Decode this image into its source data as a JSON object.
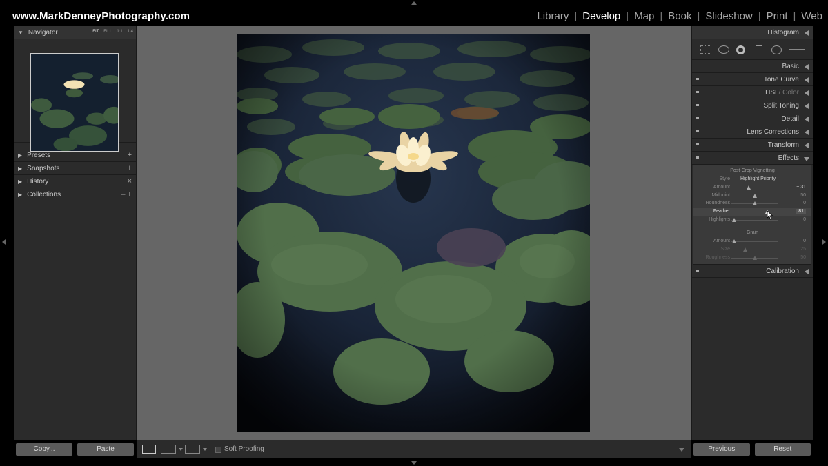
{
  "header": {
    "site_title": "www.MarkDenneyPhotography.com",
    "modules": [
      {
        "label": "Library",
        "active": false
      },
      {
        "label": "Develop",
        "active": true
      },
      {
        "label": "Map",
        "active": false
      },
      {
        "label": "Book",
        "active": false
      },
      {
        "label": "Slideshow",
        "active": false
      },
      {
        "label": "Print",
        "active": false
      },
      {
        "label": "Web",
        "active": false
      }
    ],
    "separator": "|"
  },
  "left_panel": {
    "navigator": {
      "title": "Navigator",
      "zoom_options": [
        "FIT",
        "FILL",
        "1:1",
        "1:4"
      ],
      "selected_zoom": "FIT"
    },
    "sections": [
      {
        "label": "Presets",
        "action": "+"
      },
      {
        "label": "Snapshots",
        "action": "+"
      },
      {
        "label": "History",
        "action": "×"
      },
      {
        "label": "Collections",
        "action": "– +"
      }
    ],
    "footer": {
      "copy_label": "Copy...",
      "paste_label": "Paste"
    }
  },
  "toolbar": {
    "soft_proofing_label": "Soft Proofing"
  },
  "right_panel": {
    "histogram_title": "Histogram",
    "panels": [
      {
        "label": "Basic"
      },
      {
        "label": "Tone Curve"
      },
      {
        "label": "HSL",
        "suffix": " / Color"
      },
      {
        "label": "Split Toning"
      },
      {
        "label": "Detail"
      },
      {
        "label": "Lens Corrections"
      },
      {
        "label": "Transform"
      },
      {
        "label": "Effects"
      }
    ],
    "effects": {
      "vignette_title": "Post-Crop Vignetting",
      "style_label": "Style",
      "style_value": "Highlight Priority",
      "sliders": [
        {
          "label": "Amount",
          "value": "− 31"
        },
        {
          "label": "Midpoint",
          "value": "50"
        },
        {
          "label": "Roundness",
          "value": "0"
        },
        {
          "label": "Feather",
          "value": "81"
        },
        {
          "label": "Highlights",
          "value": "0"
        }
      ],
      "grain_title": "Grain",
      "grain_sliders": [
        {
          "label": "Amount",
          "value": "0"
        },
        {
          "label": "Size",
          "value": "25"
        },
        {
          "label": "Roughness",
          "value": "50"
        }
      ]
    },
    "calibration_label": "Calibration",
    "footer": {
      "previous_label": "Previous",
      "reset_label": "Reset"
    }
  }
}
